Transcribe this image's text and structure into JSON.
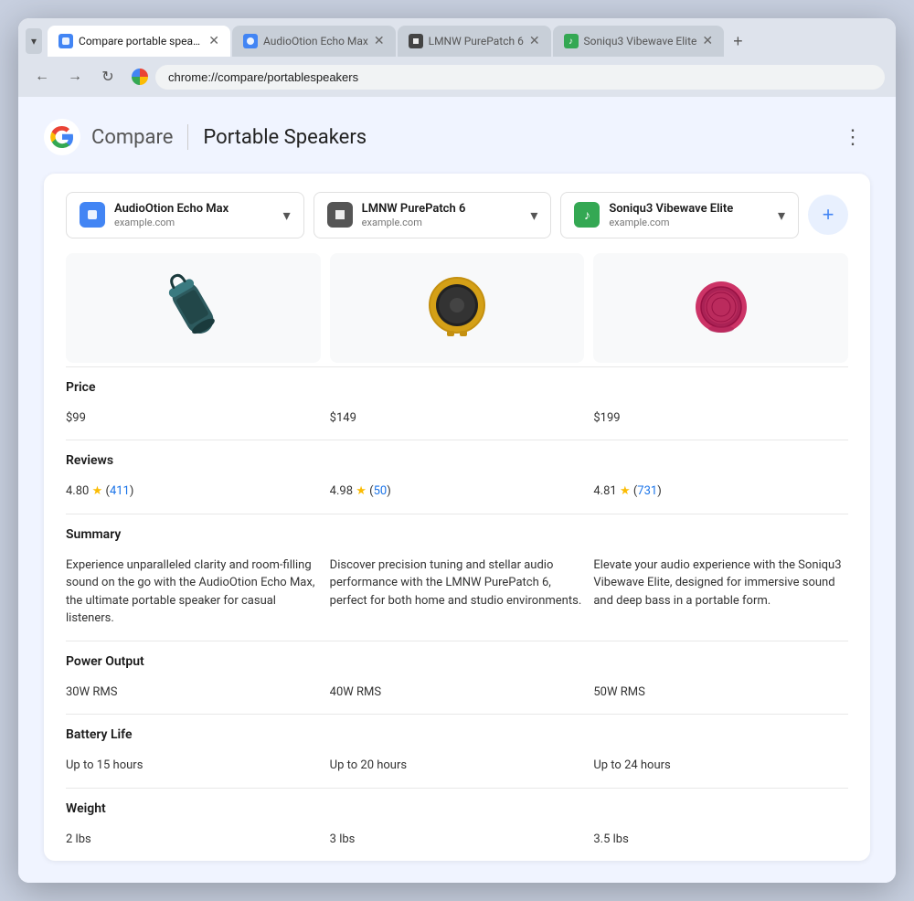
{
  "browser": {
    "tabs": [
      {
        "id": "tab1",
        "label": "Compare portable speaker",
        "icon": "🔵",
        "iconStyle": "blue",
        "active": true
      },
      {
        "id": "tab2",
        "label": "AudioOtion Echo Max",
        "icon": "🔵",
        "iconStyle": "blue",
        "active": false
      },
      {
        "id": "tab3",
        "label": "LMNW PurePatch 6",
        "icon": "⬛",
        "iconStyle": "dark",
        "active": false
      },
      {
        "id": "tab4",
        "label": "Soniqu3 Vibewave Elite",
        "icon": "🎵",
        "iconStyle": "green",
        "active": false
      }
    ],
    "url": "chrome://compare/portablespeakers",
    "new_tab_label": "+"
  },
  "page": {
    "logo_alt": "Google",
    "compare_label": "Compare",
    "title": "Portable Speakers",
    "more_icon": "⋮"
  },
  "products": [
    {
      "id": "p1",
      "name": "AudioOtion Echo Max",
      "domain": "example.com",
      "icon_style": "blue",
      "price": "$99",
      "rating": "4.80",
      "review_count": "411",
      "summary": "Experience unparalleled clarity and room-filling sound on the go with the AudioOtion Echo Max, the ultimate portable speaker for casual listeners.",
      "power_output": "30W RMS",
      "battery_life": "Up to 15 hours",
      "weight": "2 lbs"
    },
    {
      "id": "p2",
      "name": "LMNW PurePatch 6",
      "domain": "example.com",
      "icon_style": "gray",
      "price": "$149",
      "rating": "4.98",
      "review_count": "50",
      "summary": "Discover precision tuning and stellar audio performance with the LMNW PurePatch 6, perfect for both home and studio environments.",
      "power_output": "40W RMS",
      "battery_life": "Up to 20 hours",
      "weight": "3 lbs"
    },
    {
      "id": "p3",
      "name": "Soniqu3 Vibewave Elite",
      "domain": "example.com",
      "icon_style": "green",
      "price": "$199",
      "rating": "4.81",
      "review_count": "731",
      "summary": "Elevate your audio experience with the Soniqu3 Vibewave Elite, designed for immersive sound and deep bass in a portable form.",
      "power_output": "50W RMS",
      "battery_life": "Up to 24 hours",
      "weight": "3.5 lbs"
    }
  ],
  "labels": {
    "price": "Price",
    "reviews": "Reviews",
    "summary": "Summary",
    "power_output": "Power Output",
    "battery_life": "Battery Life",
    "weight": "Weight",
    "add": "+"
  }
}
